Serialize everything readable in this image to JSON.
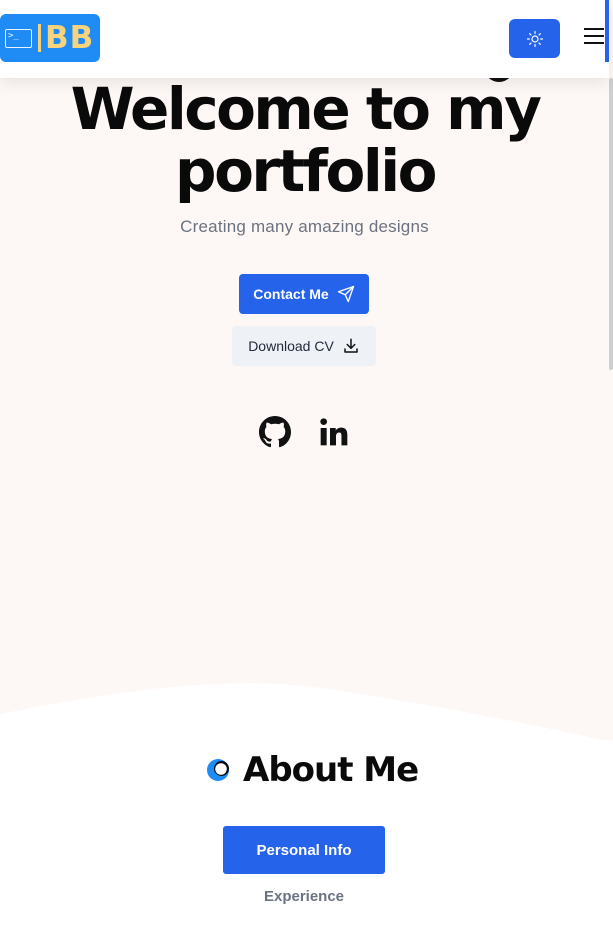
{
  "header": {
    "logo_text": "BB",
    "logo_prompt": ">_",
    "theme_icon": "sun-icon",
    "menu_icon": "hamburger-menu-icon"
  },
  "hero": {
    "title_line1": "Welcome to my",
    "title_line2": "portfolio",
    "subtitle": "Creating many amazing designs",
    "contact_label": "Contact Me",
    "contact_icon": "send-icon",
    "download_label": "Download CV",
    "download_icon": "download-icon",
    "socials": [
      "github-icon",
      "linkedin-icon"
    ]
  },
  "about": {
    "title": "About Me",
    "tabs": [
      {
        "label": "Personal Info",
        "active": true
      },
      {
        "label": "Experience",
        "active": false
      }
    ]
  },
  "colors": {
    "accent": "#2563eb",
    "hero_bg": "#fdf8f5",
    "section_bg": "#ffffff",
    "logo_bg": "#1f8bf5",
    "logo_text": "#f6d37c"
  }
}
